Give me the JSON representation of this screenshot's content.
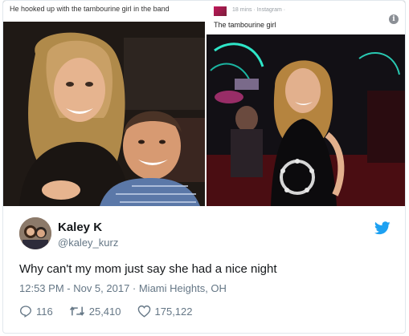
{
  "left_photo": {
    "caption": "He hooked up with the tambourine girl in the band"
  },
  "right_photo": {
    "meta": "18 mins · Instagram · ",
    "caption": "The tambourine girl",
    "info_glyph": "i"
  },
  "tweet": {
    "name": "Kaley K",
    "handle": "@kaley_kurz",
    "text": "Why can't my mom just say she had a nice night",
    "meta": "12:53 PM - Nov 5, 2017 · Miami Heights, OH",
    "replies": "116",
    "retweets": "25,410",
    "likes": "175,122"
  },
  "icons": {
    "reply": "reply-icon",
    "retweet": "retweet-icon",
    "like": "heart-icon",
    "brand": "twitter-bird-icon",
    "info": "info-icon"
  },
  "colors": {
    "twitter_blue": "#1da1f2",
    "secondary_text": "#657786",
    "primary_text": "#14171a",
    "border": "#e1e8ed"
  }
}
